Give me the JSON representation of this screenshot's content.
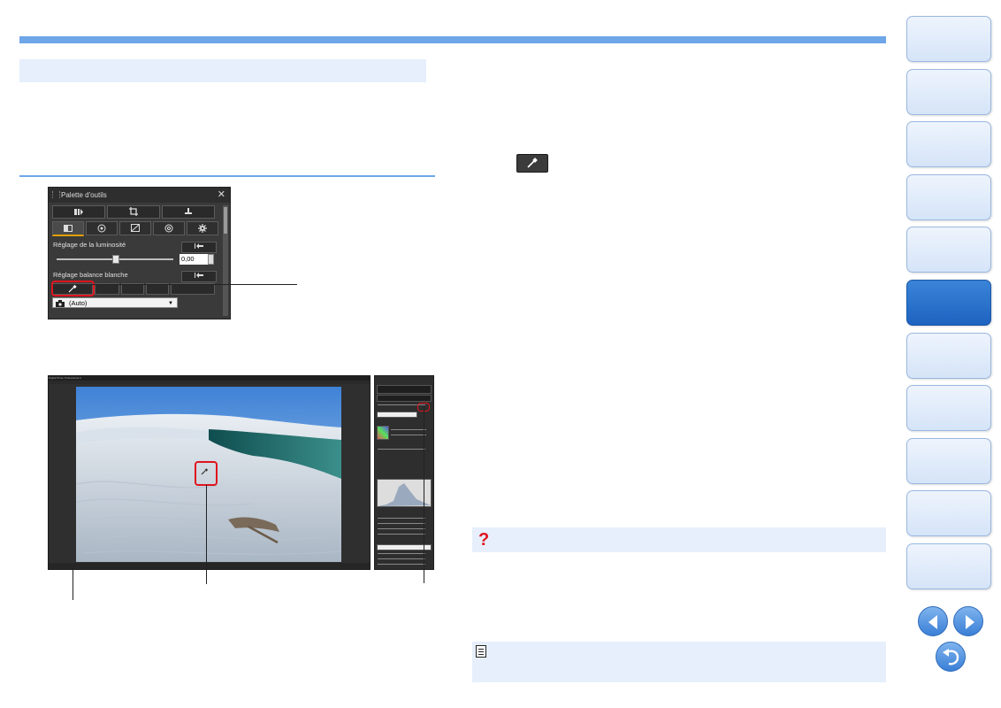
{
  "palette": {
    "title": "Palette d'outils",
    "brightness_label": "Réglage de la luminosité",
    "brightness_value": "0,00",
    "brightness_level": 0.5,
    "wb_label": "Réglage balance blanche",
    "wb_select": "(Auto)"
  },
  "main_window": {
    "title": "Digital Photo Professional 4"
  },
  "nav": {
    "tab_count": 11,
    "active_index": 5
  },
  "colors": {
    "accent": "#6ea6e8",
    "highlight": "#e0141e",
    "nav_active": "#1e63c0"
  }
}
